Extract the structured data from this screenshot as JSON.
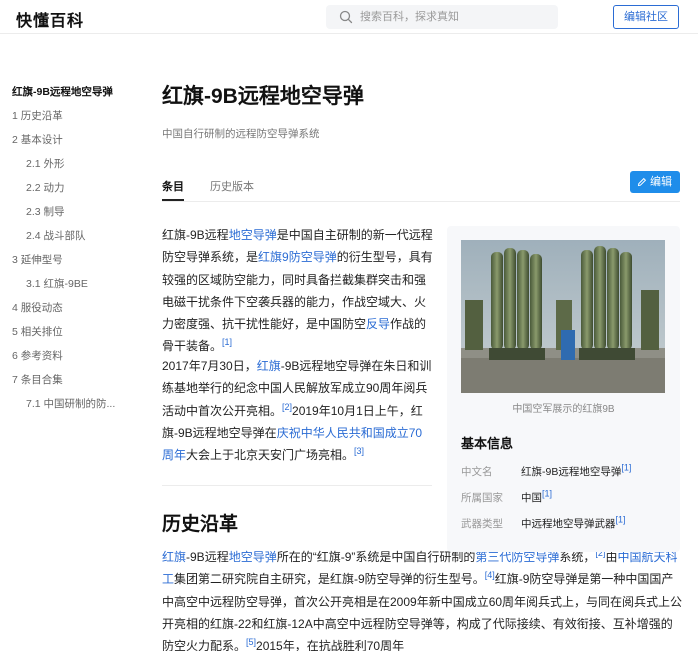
{
  "header": {
    "logo": "快懂百科",
    "search_placeholder": "搜索百科，探求真知",
    "edit_community": "编辑社区"
  },
  "toc": [
    {
      "label": "红旗-9B远程地空导弹",
      "level": 1,
      "active": true
    },
    {
      "label": "1 历史沿革",
      "level": 1
    },
    {
      "label": "2 基本设计",
      "level": 1
    },
    {
      "label": "2.1 外形",
      "level": 2
    },
    {
      "label": "2.2 动力",
      "level": 2
    },
    {
      "label": "2.3 制导",
      "level": 2
    },
    {
      "label": "2.4 战斗部队",
      "level": 2
    },
    {
      "label": "3 延伸型号",
      "level": 1
    },
    {
      "label": "3.1 红旗-9BE",
      "level": 2
    },
    {
      "label": "4 服役动态",
      "level": 1
    },
    {
      "label": "5 相关排位",
      "level": 1
    },
    {
      "label": "6 参考资料",
      "level": 1
    },
    {
      "label": "7 条目合集",
      "level": 1
    },
    {
      "label": "7.1 中国研制的防...",
      "level": 2
    }
  ],
  "article": {
    "title": "红旗-9B远程地空导弹",
    "subtitle": "中国自行研制的远程防空导弹系统",
    "tabs": [
      "条目",
      "历史版本"
    ],
    "edit_label": "编辑",
    "para1": [
      {
        "t": "红旗-9B远程"
      },
      {
        "t": "地空导弹",
        "link": true
      },
      {
        "t": "是中国自主研制的新一代远程防空导弹系统，是"
      },
      {
        "t": "红旗9防空导弹",
        "link": true
      },
      {
        "t": "的衍生型号，具有较强的区域防空能力，同时具备拦截集群突击和强电磁干扰条件下空袭兵器的能力，作战空域大、火力密度强、抗干扰性能好，是中国防空"
      },
      {
        "t": "反导",
        "link": true
      },
      {
        "t": "作战的骨干装备。"
      },
      {
        "t": "[1]",
        "ref": true
      }
    ],
    "para2": [
      {
        "t": "2017年7月30日，"
      },
      {
        "t": "红旗",
        "link": true
      },
      {
        "t": "-9B远程地空导弹在朱日和训练基地举行的纪念中国人民解放军成立90周年阅兵活动中首次公开亮相。"
      },
      {
        "t": "[2]",
        "ref": true
      },
      {
        "t": "2019年10月1日上午，红旗-9B远程地空导弹在"
      },
      {
        "t": "庆祝中华人民共和国成立70周年",
        "link": true
      },
      {
        "t": "大会上于北京天安门广场亮相。"
      },
      {
        "t": "[3]",
        "ref": true
      }
    ],
    "section1_title": "历史沿革",
    "para3": [
      {
        "t": "红旗",
        "link": true
      },
      {
        "t": "-9B远程"
      },
      {
        "t": "地空导弹",
        "link": true
      },
      {
        "t": "所在的“红旗-9”系统是中国自行研制的"
      },
      {
        "t": "第三代防空导弹",
        "link": true
      },
      {
        "t": "系统，"
      },
      {
        "t": "[2]",
        "ref": true
      },
      {
        "t": "由"
      },
      {
        "t": "中国航天科工",
        "link": true
      },
      {
        "t": "集团第二研究院自主研究，是红旗-9防空导弹的衍生型号。"
      },
      {
        "t": "[4]",
        "ref": true
      },
      {
        "t": "红旗-9防空导弹是第一种中国国产中高空中远程防空导弹，首次公开亮相是在2009年新中国成立60周年阅兵式上，与同在阅兵式上公开亮相的红旗-22和红旗-12A中高空中远程防空导弹等，构成了代际接续、有效衔接、互补增强的防空火力配系。"
      },
      {
        "t": "[5]",
        "ref": true
      },
      {
        "t": "2015年，在抗战胜利70周年"
      }
    ]
  },
  "infobox": {
    "caption": "中国空军展示的红旗9B",
    "title": "基本信息",
    "rows": [
      {
        "key": "中文名",
        "value": "红旗-9B远程地空导弹",
        "ref": "[1]"
      },
      {
        "key": "所属国家",
        "value": "中国",
        "ref": "[1]"
      },
      {
        "key": "武器类型",
        "value": "中远程地空导弹武器",
        "ref": "[1]"
      }
    ]
  },
  "colors": {
    "link": "#2b6cd4",
    "accent_button": "#1f8dea"
  }
}
